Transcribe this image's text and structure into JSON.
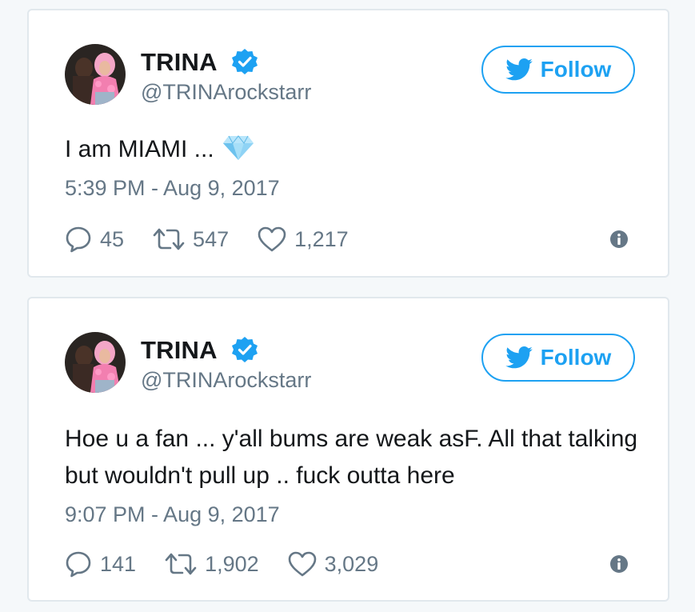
{
  "tweets": [
    {
      "name": "TRINA",
      "handle": "@TRINArockstarr",
      "follow_label": "Follow",
      "text": "I am MIAMI ...",
      "emoji": "diamond-icon",
      "timestamp": "5:39 PM - Aug 9, 2017",
      "replies": "45",
      "retweets": "547",
      "likes": "1,217"
    },
    {
      "name": "TRINA",
      "handle": "@TRINArockstarr",
      "follow_label": "Follow",
      "text": "Hoe u a fan ... y'all bums are weak asF. All that talking but wouldn't pull up .. fuck outta here",
      "timestamp": "9:07 PM - Aug 9, 2017",
      "replies": "141",
      "retweets": "1,902",
      "likes": "3,029"
    }
  ],
  "colors": {
    "brand_blue": "#1da1f2",
    "text_dark": "#14171a",
    "text_gray": "#657786",
    "border": "#e1e8ed"
  }
}
